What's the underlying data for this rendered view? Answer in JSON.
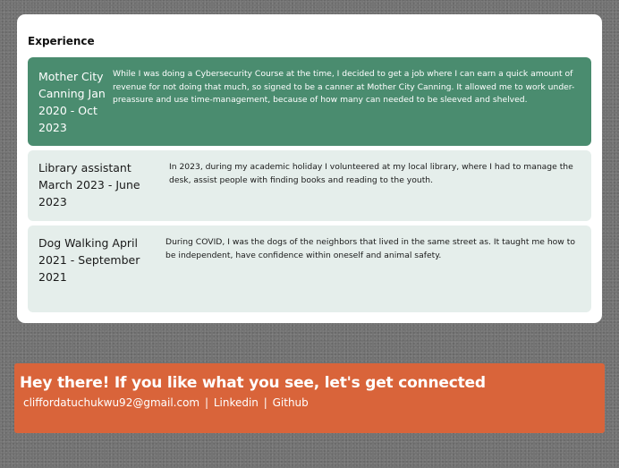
{
  "experience": {
    "title": "Experience",
    "items": [
      {
        "role": "Mother City Canning Jan 2020 - Oct 2023",
        "description": "While I was doing a Cybersecurity Course at the time, I decided to get a job where I can earn a quick amount of revenue for not doing that much, so signed to be a canner at Mother City Canning. It allowed me to work under-preassure and use time-management, because of how many can needed to be sleeved and shelved."
      },
      {
        "role": "Library assistant March 2023 - June 2023",
        "description": "In 2023, during my academic holiday I volunteered at my local library, where I had to manage the desk, assist people with finding books and reading to the youth."
      },
      {
        "role": "Dog Walking April 2021 - September 2021",
        "description": "During COVID, I was the dogs of the neighbors that lived in the same street as. It taught me how to be independent, have confidence within oneself and animal safety."
      }
    ],
    "colors": {
      "active_bg": "#4a8c6f",
      "item_bg": "#e5eeeb"
    }
  },
  "contact": {
    "heading": "Hey there! If you like what you see, let's get connected",
    "email": "cliffordatuchukwu92@gmail.com",
    "separator": "|",
    "linkedin": "Linkedin",
    "github": "Github",
    "color": "#d9643a"
  }
}
